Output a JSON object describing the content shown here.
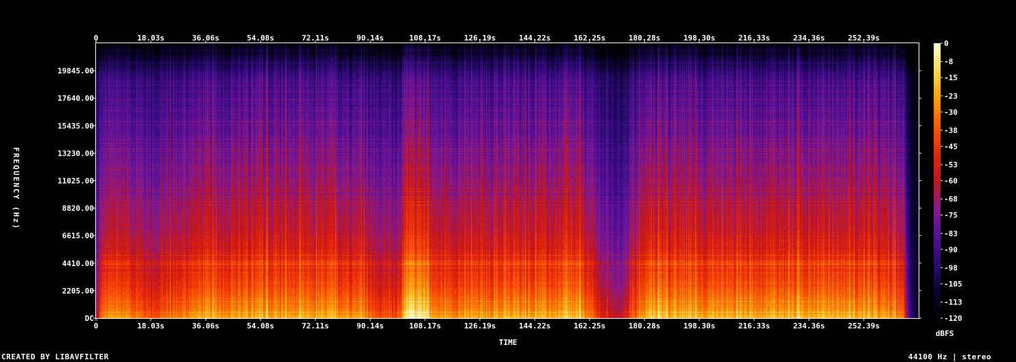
{
  "chart_data": {
    "type": "heatmap",
    "xlabel": "TIME",
    "ylabel": "FREQUENCY (Hz)",
    "x_ticks": [
      "0",
      "18.03s",
      "36.06s",
      "54.08s",
      "72.11s",
      "90.14s",
      "108.17s",
      "126.19s",
      "144.22s",
      "162.25s",
      "180.28s",
      "198.30s",
      "216.33s",
      "234.36s",
      "252.39s"
    ],
    "x_tick_values": [
      0,
      18.03,
      36.06,
      54.08,
      72.11,
      90.14,
      108.17,
      126.19,
      144.22,
      162.25,
      180.28,
      198.3,
      216.33,
      234.36,
      252.39
    ],
    "x_range": [
      0,
      270.4
    ],
    "y_ticks": [
      "DC",
      "2205.00",
      "4410.00",
      "6615.00",
      "8820.00",
      "11025.00",
      "13230.00",
      "15435.00",
      "17640.00",
      "19845.00"
    ],
    "y_tick_values": [
      0,
      2205,
      4410,
      6615,
      8820,
      11025,
      13230,
      15435,
      17640,
      19845
    ],
    "y_range": [
      0,
      22050
    ],
    "colorbar": {
      "label": "dBFS",
      "ticks": [
        "0",
        "-8",
        "-15",
        "-23",
        "-30",
        "-38",
        "-45",
        "-53",
        "-60",
        "-68",
        "-75",
        "-83",
        "-90",
        "-98",
        "-105",
        "-113",
        "-120"
      ],
      "range": [
        -120,
        0
      ]
    },
    "colors": [
      "#000000",
      "#0b0233",
      "#2a0a72",
      "#55109a",
      "#8a1a8c",
      "#c0161c",
      "#e8260a",
      "#ff5a00",
      "#ffa000",
      "#ffd84a",
      "#ffffe0"
    ],
    "time_profile": {
      "t": [
        0,
        2,
        10,
        14,
        18,
        30,
        34,
        88,
        92,
        99,
        103,
        108,
        111,
        160,
        166,
        172,
        176,
        183,
        190,
        242,
        255,
        265,
        267,
        270.4
      ],
      "level": [
        0.45,
        0.8,
        0.82,
        0.75,
        0.7,
        0.8,
        0.84,
        0.84,
        0.68,
        0.72,
        1.0,
        1.0,
        0.82,
        0.86,
        0.6,
        0.5,
        0.7,
        0.92,
        0.86,
        0.88,
        0.84,
        0.8,
        0.3,
        0.05
      ]
    }
  },
  "footer": {
    "left": "CREATED BY LIBAVFILTER",
    "right": "44100 Hz | stereo"
  }
}
